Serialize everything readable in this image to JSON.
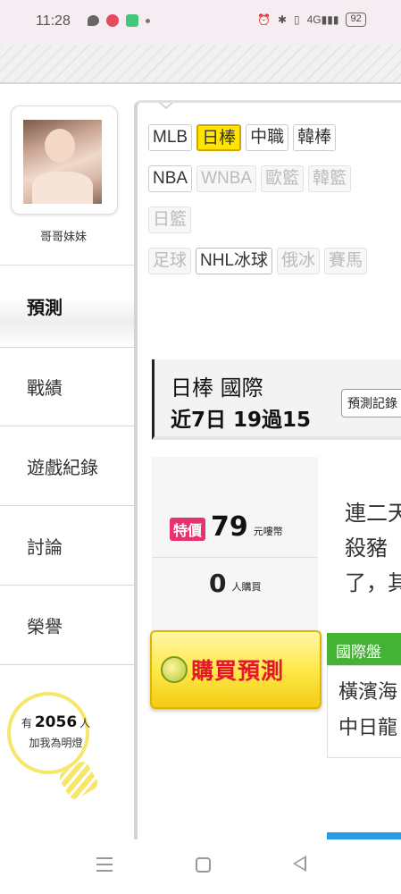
{
  "status_bar": {
    "time": "11:28",
    "battery": "92",
    "network": "4G"
  },
  "sidebar": {
    "user_name": "哥哥妹妹",
    "items": [
      {
        "label": "預測",
        "active": true
      },
      {
        "label": "戰績"
      },
      {
        "label": "遊戲紀錄"
      },
      {
        "label": "討論"
      },
      {
        "label": "榮譽"
      }
    ],
    "lamp": {
      "prefix": "有",
      "count": "2056",
      "suffix": "人",
      "caption": "加我為明燈"
    }
  },
  "categories": {
    "row1": [
      "MLB",
      "日棒",
      "中職",
      "韓棒"
    ],
    "row2": [
      "NBA",
      "WNBA",
      "歐籃",
      "韓籃"
    ],
    "row3": [
      "日籃"
    ],
    "row4": [
      "足球",
      "NHL冰球",
      "俄冰",
      "賽馬"
    ],
    "active": "日棒"
  },
  "card": {
    "title": "日棒 國際",
    "subtitle": "近7日 19過15",
    "record_button": "預測記錄",
    "special_label": "特價",
    "price": "79",
    "price_unit": "元嘍幣",
    "buyers": "0",
    "buyers_unit": "人購買",
    "buy_button": "購買預測",
    "preview_lines": [
      "連二天",
      "殺豬",
      "了，其"
    ],
    "market_tab": "國際盤",
    "match_lines": [
      "橫濱海",
      "中日龍"
    ]
  },
  "colors": {
    "accent_yellow": "#ffe500",
    "special_pink": "#e8326e",
    "buy_red": "#e5162c",
    "market_green": "#44b234"
  }
}
